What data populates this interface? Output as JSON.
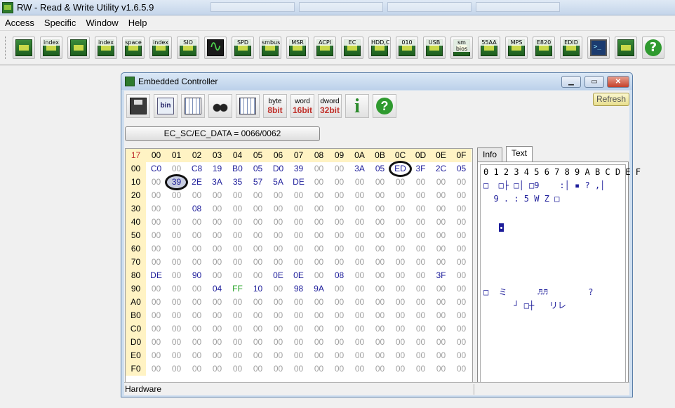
{
  "app": {
    "title": "RW - Read & Write Utility v1.6.5.9"
  },
  "menu": [
    "Access",
    "Specific",
    "Window",
    "Help"
  ],
  "toolbar": [
    {
      "name": "pci-icon",
      "label": ""
    },
    {
      "name": "index-io-icon",
      "label": "index"
    },
    {
      "name": "memory-icon",
      "label": ""
    },
    {
      "name": "index-memory-icon",
      "label": "index"
    },
    {
      "name": "io-space-icon",
      "label": "space"
    },
    {
      "name": "io-index-icon",
      "label": "index"
    },
    {
      "name": "sio-icon",
      "label": "SIO"
    },
    {
      "name": "waveform-icon",
      "label": ""
    },
    {
      "name": "spd-icon",
      "label": "SPD"
    },
    {
      "name": "smbus-icon",
      "label": "smbus"
    },
    {
      "name": "msr-icon",
      "label": "MSR"
    },
    {
      "name": "acpi-icon",
      "label": "ACPI"
    },
    {
      "name": "ec-icon",
      "label": "EC"
    },
    {
      "name": "hdd-cd-icon",
      "label": "HDD,CD"
    },
    {
      "name": "disk-010-icon",
      "label": "010"
    },
    {
      "name": "usb-icon",
      "label": "USB"
    },
    {
      "name": "sm-bios-icon",
      "label": "sm bios"
    },
    {
      "name": "55aa-icon",
      "label": "55AA"
    },
    {
      "name": "mps-icon",
      "label": "MPS"
    },
    {
      "name": "e820-icon",
      "label": "E820"
    },
    {
      "name": "edid-icon",
      "label": "EDID"
    },
    {
      "name": "command-icon",
      "label": ""
    },
    {
      "name": "device-icon",
      "label": ""
    },
    {
      "name": "help-icon",
      "label": "?"
    }
  ],
  "ec_window": {
    "title": "Embedded Controller",
    "refresh_label": "Refresh",
    "address": "EC_SC/EC_DATA = 0066/0062",
    "width_buttons": [
      {
        "top": "byte",
        "bottom": "8bit",
        "color": "#c0302a"
      },
      {
        "top": "word",
        "bottom": "16bit",
        "color": "#c0302a"
      },
      {
        "top": "dword",
        "bottom": "32bit",
        "color": "#c0302a"
      }
    ],
    "tabs": [
      "Info",
      "Text"
    ],
    "status": "Hardware"
  },
  "hex": {
    "corner": "17",
    "cols": [
      "00",
      "01",
      "02",
      "03",
      "04",
      "05",
      "06",
      "07",
      "08",
      "09",
      "0A",
      "0B",
      "0C",
      "0D",
      "0E",
      "0F"
    ],
    "rows": [
      {
        "label": "00",
        "values": [
          "C0",
          "00",
          "C8",
          "19",
          "B0",
          "05",
          "D0",
          "39",
          "00",
          "00",
          "3A",
          "05",
          "ED",
          "3F",
          "2C",
          "05"
        ]
      },
      {
        "label": "10",
        "values": [
          "00",
          "39",
          "2E",
          "3A",
          "35",
          "57",
          "5A",
          "DE",
          "00",
          "00",
          "00",
          "00",
          "00",
          "00",
          "00",
          "00"
        ]
      },
      {
        "label": "20",
        "values": [
          "00",
          "00",
          "00",
          "00",
          "00",
          "00",
          "00",
          "00",
          "00",
          "00",
          "00",
          "00",
          "00",
          "00",
          "00",
          "00"
        ]
      },
      {
        "label": "30",
        "values": [
          "00",
          "00",
          "08",
          "00",
          "00",
          "00",
          "00",
          "00",
          "00",
          "00",
          "00",
          "00",
          "00",
          "00",
          "00",
          "00"
        ]
      },
      {
        "label": "40",
        "values": [
          "00",
          "00",
          "00",
          "00",
          "00",
          "00",
          "00",
          "00",
          "00",
          "00",
          "00",
          "00",
          "00",
          "00",
          "00",
          "00"
        ]
      },
      {
        "label": "50",
        "values": [
          "00",
          "00",
          "00",
          "00",
          "00",
          "00",
          "00",
          "00",
          "00",
          "00",
          "00",
          "00",
          "00",
          "00",
          "00",
          "00"
        ]
      },
      {
        "label": "60",
        "values": [
          "00",
          "00",
          "00",
          "00",
          "00",
          "00",
          "00",
          "00",
          "00",
          "00",
          "00",
          "00",
          "00",
          "00",
          "00",
          "00"
        ]
      },
      {
        "label": "70",
        "values": [
          "00",
          "00",
          "00",
          "00",
          "00",
          "00",
          "00",
          "00",
          "00",
          "00",
          "00",
          "00",
          "00",
          "00",
          "00",
          "00"
        ]
      },
      {
        "label": "80",
        "values": [
          "DE",
          "00",
          "90",
          "00",
          "00",
          "00",
          "0E",
          "0E",
          "00",
          "08",
          "00",
          "00",
          "00",
          "00",
          "3F",
          "00"
        ]
      },
      {
        "label": "90",
        "values": [
          "00",
          "00",
          "00",
          "04",
          "FF",
          "10",
          "00",
          "98",
          "9A",
          "00",
          "00",
          "00",
          "00",
          "00",
          "00",
          "00"
        ]
      },
      {
        "label": "A0",
        "values": [
          "00",
          "00",
          "00",
          "00",
          "00",
          "00",
          "00",
          "00",
          "00",
          "00",
          "00",
          "00",
          "00",
          "00",
          "00",
          "00"
        ]
      },
      {
        "label": "B0",
        "values": [
          "00",
          "00",
          "00",
          "00",
          "00",
          "00",
          "00",
          "00",
          "00",
          "00",
          "00",
          "00",
          "00",
          "00",
          "00",
          "00"
        ]
      },
      {
        "label": "C0",
        "values": [
          "00",
          "00",
          "00",
          "00",
          "00",
          "00",
          "00",
          "00",
          "00",
          "00",
          "00",
          "00",
          "00",
          "00",
          "00",
          "00"
        ]
      },
      {
        "label": "D0",
        "values": [
          "00",
          "00",
          "00",
          "00",
          "00",
          "00",
          "00",
          "00",
          "00",
          "00",
          "00",
          "00",
          "00",
          "00",
          "00",
          "00"
        ]
      },
      {
        "label": "E0",
        "values": [
          "00",
          "00",
          "00",
          "00",
          "00",
          "00",
          "00",
          "00",
          "00",
          "00",
          "00",
          "00",
          "00",
          "00",
          "00",
          "00"
        ]
      },
      {
        "label": "F0",
        "values": [
          "00",
          "00",
          "00",
          "00",
          "00",
          "00",
          "00",
          "00",
          "00",
          "00",
          "00",
          "00",
          "00",
          "00",
          "00",
          "00"
        ]
      }
    ],
    "selected_cell": "10:01",
    "circled_cell": "00:0C"
  },
  "text_pane": {
    "header": "0 1 2 3 4 5 6 7 8 9 A B C D E F",
    "lines": [
      {
        "row": 0,
        "text": "□  □├ □│ □9    :│ ▪ ? ,│"
      },
      {
        "row": 1,
        "text": "  9 . : 5 W Z □"
      },
      {
        "row": 8,
        "text": "□  ミ      ♬♬        ?"
      },
      {
        "row": 9,
        "text": "      ┘ □┼   リレ"
      }
    ]
  }
}
